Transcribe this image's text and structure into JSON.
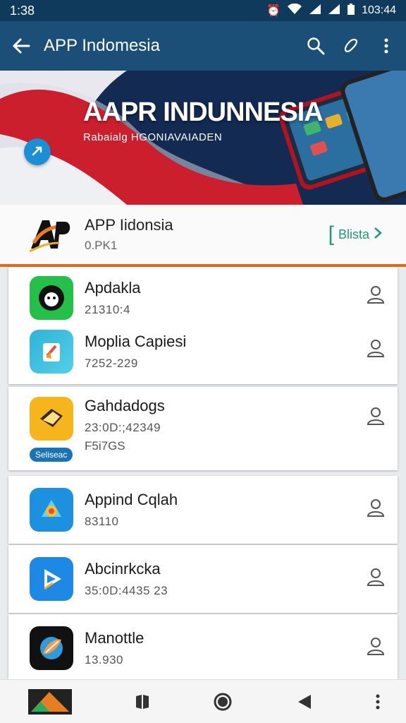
{
  "status_bar": {
    "time": "1:38",
    "right_time": "103:44",
    "icons": [
      "alarm-icon",
      "wifi-icon",
      "signal-icon",
      "signal-icon",
      "battery-icon"
    ]
  },
  "app_bar": {
    "title": "APP Indomesia",
    "icons": [
      "back-arrow-icon",
      "search-icon",
      "edit-icon",
      "more-vert-icon"
    ]
  },
  "banner": {
    "title": "AAPR INDUNNESIA",
    "subtitle": "Rabaialg HGONIAVAIADEN"
  },
  "header": {
    "name": "APP Iidonsia",
    "code": "0.PK1",
    "action_label": "Blista"
  },
  "apps": [
    {
      "name": "Apdakla",
      "meta": "21310:4",
      "icon_color": "#25c04a"
    },
    {
      "name": "Moplia Capiesi",
      "meta": "7252-229",
      "icon_color": "#2fb3d8"
    },
    {
      "name": "Gahdadogs",
      "meta": "23:0D:;42349",
      "meta2": "F5i7GS",
      "badge": "Seliseac",
      "icon_color": "#f6b51c"
    },
    {
      "name": "Appind Cqlah",
      "meta": "83110",
      "icon_color": "#1d91e0"
    },
    {
      "name": "Abcinrkcka",
      "meta": "35:0D:4435 23",
      "icon_color": "#1e88e5"
    },
    {
      "name": "Manottle",
      "meta": "13.930",
      "icon_color": "#111111"
    }
  ],
  "colors": {
    "status_bar": "#0f3a5c",
    "app_bar": "#1b4f78",
    "accent_orange": "#e06a1e",
    "accent_green": "#1c9b74"
  }
}
